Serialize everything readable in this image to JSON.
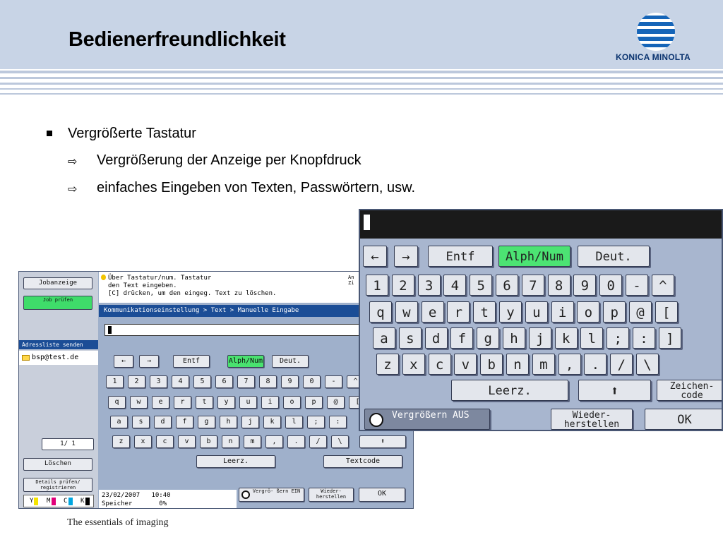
{
  "slide": {
    "title": "Bedienerfreundlichkeit",
    "logo_text": "KONICA MINOLTA",
    "footer": "The essentials of imaging",
    "bullet_main": "Vergrößerte Tastatur",
    "sub_bullets": [
      "Vergrößerung der Anzeige per Knopfdruck",
      "einfaches Eingeben von Texten, Passwörtern, usw."
    ],
    "arrow_glyph": "⇨"
  },
  "device": {
    "left": {
      "job_button": "Jobanzeige",
      "job_check": "Job prüfen",
      "addr_header": "Adressliste senden",
      "addr_entry": "bsp@test.de",
      "page": "1/  1",
      "delete": "Löschen",
      "details": "Details prüfen/ registrieren",
      "cmyk": [
        "Y",
        "M",
        "C",
        "K"
      ]
    },
    "message": [
      "Über Tastatur/num. Tastatur",
      "den Text eingeben.",
      "[C] drücken, um den eingeg. Text zu löschen."
    ],
    "top_right": "An Zi",
    "breadcrumb": "Kommunikationseinstellung > Text > Manuelle Eingabe",
    "keys": {
      "row0": [
        "←",
        "→",
        "Entf",
        "Alph/Num",
        "Deut."
      ],
      "row1": [
        "1",
        "2",
        "3",
        "4",
        "5",
        "6",
        "7",
        "8",
        "9",
        "0",
        "-",
        "^"
      ],
      "row2": [
        "q",
        "w",
        "e",
        "r",
        "t",
        "y",
        "u",
        "i",
        "o",
        "p",
        "@",
        "["
      ],
      "row3": [
        "a",
        "s",
        "d",
        "f",
        "g",
        "h",
        "j",
        "k",
        "l",
        ";",
        ":"
      ],
      "row4": [
        "z",
        "x",
        "c",
        "v",
        "b",
        "n",
        "m",
        ",",
        ".",
        "/",
        "\\"
      ],
      "shift": "⬆",
      "space": "Leerz.",
      "textcode": "Textcode",
      "zoom": "Vergrö- ßern EIN",
      "restore": "Wieder- herstellen",
      "ok": "OK"
    },
    "status": {
      "date": "23/02/2007",
      "time": "10:40",
      "memory_label": "Speicher",
      "memory": "0%"
    }
  },
  "big_keyboard": {
    "row0": [
      "←",
      "→",
      "Entf",
      "Alph/Num",
      "Deut."
    ],
    "row1": [
      "1",
      "2",
      "3",
      "4",
      "5",
      "6",
      "7",
      "8",
      "9",
      "0",
      "-",
      "^"
    ],
    "row2": [
      "q",
      "w",
      "e",
      "r",
      "t",
      "y",
      "u",
      "i",
      "o",
      "p",
      "@",
      "["
    ],
    "row3": [
      "a",
      "s",
      "d",
      "f",
      "g",
      "h",
      "j",
      "k",
      "l",
      ";",
      ":",
      "]"
    ],
    "row4": [
      "z",
      "x",
      "c",
      "v",
      "b",
      "n",
      "m",
      ",",
      ".",
      "/",
      "\\"
    ],
    "space": "Leerz.",
    "shift": "⬆",
    "zeichencode": "Zeichen- code",
    "zoom": "Vergrößern AUS",
    "restore": "Wieder- herstellen",
    "ok": "OK"
  },
  "colors": {
    "header": "#c8d4e6",
    "brand_blue": "#1665b8",
    "green_key": "#4ce373"
  }
}
